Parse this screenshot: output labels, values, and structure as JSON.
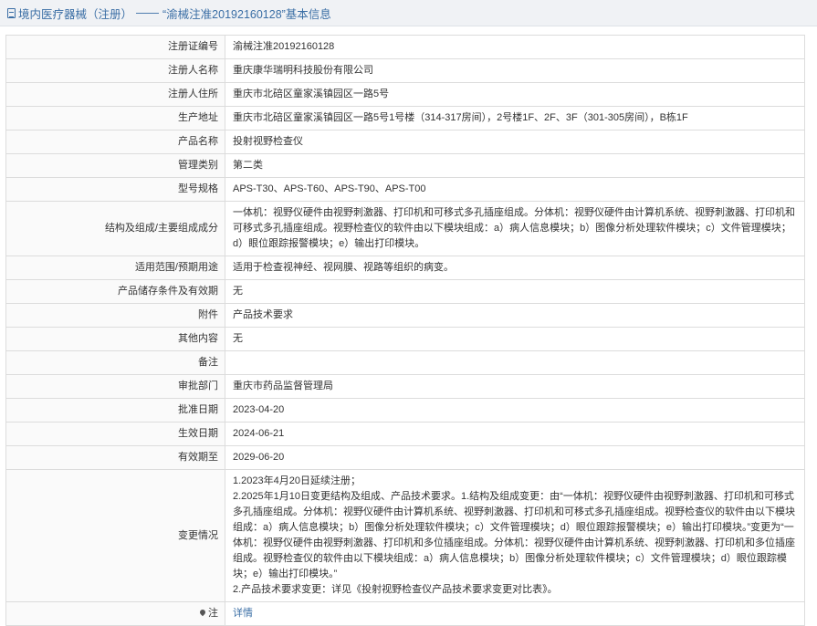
{
  "header": {
    "section": "境内医疗器械（注册）",
    "separator": "——",
    "title": "“渝械注准20192160128”基本信息"
  },
  "rows": [
    {
      "label": "注册证编号",
      "value": "渝械注准20192160128"
    },
    {
      "label": "注册人名称",
      "value": "重庆康华瑞明科技股份有限公司"
    },
    {
      "label": "注册人住所",
      "value": "重庆市北碚区童家溪镇园区一路5号"
    },
    {
      "label": "生产地址",
      "value": "重庆市北碚区童家溪镇园区一路5号1号楼（314-317房间），2号楼1F、2F、3F（301-305房间），B栋1F"
    },
    {
      "label": "产品名称",
      "value": "投射视野检查仪"
    },
    {
      "label": "管理类别",
      "value": "第二类"
    },
    {
      "label": "型号规格",
      "value": "APS-T30、APS-T60、APS-T90、APS-T00"
    },
    {
      "label": "结构及组成/主要组成成分",
      "value": "一体机：视野仪硬件由视野刺激器、打印机和可移式多孔插座组成。分体机：视野仪硬件由计算机系统、视野刺激器、打印机和可移式多孔插座组成。视野检查仪的软件由以下模块组成：a）病人信息模块；b）图像分析处理软件模块；c）文件管理模块；d）眼位跟踪报警模块；e）输出打印模块。"
    },
    {
      "label": "适用范围/预期用途",
      "value": "适用于检查视神经、视网膜、视路等组织的病变。"
    },
    {
      "label": "产品储存条件及有效期",
      "value": "无"
    },
    {
      "label": "附件",
      "value": "产品技术要求"
    },
    {
      "label": "其他内容",
      "value": "无"
    },
    {
      "label": "备注",
      "value": ""
    },
    {
      "label": "审批部门",
      "value": "重庆市药品监督管理局"
    },
    {
      "label": "批准日期",
      "value": "2023-04-20"
    },
    {
      "label": "生效日期",
      "value": "2024-06-21"
    },
    {
      "label": "有效期至",
      "value": "2029-06-20"
    }
  ],
  "changes": {
    "label": "变更情况",
    "lines": [
      "1.2023年4月20日延续注册；",
      "2.2025年1月10日变更结构及组成、产品技术要求。1.结构及组成变更：由“一体机：视野仪硬件由视野刺激器、打印机和可移式多孔插座组成。分体机：视野仪硬件由计算机系统、视野刺激器、打印机和可移式多孔插座组成。视野检查仪的软件由以下模块组成：a）病人信息模块；b）图像分析处理软件模块；c）文件管理模块；d）眼位跟踪报警模块；e）输出打印模块。”变更为“一体机：视野仪硬件由视野刺激器、打印机和多位插座组成。分体机：视野仪硬件由计算机系统、视野刺激器、打印机和多位插座组成。视野检查仪的软件由以下模块组成：a）病人信息模块；b）图像分析处理软件模块；c）文件管理模块；d）眼位跟踪模块；e）输出打印模块。”",
      "2.产品技术要求变更：详见《投射视野检查仪产品技术要求变更对比表》。"
    ]
  },
  "note": {
    "label": "注",
    "link": "详情"
  }
}
